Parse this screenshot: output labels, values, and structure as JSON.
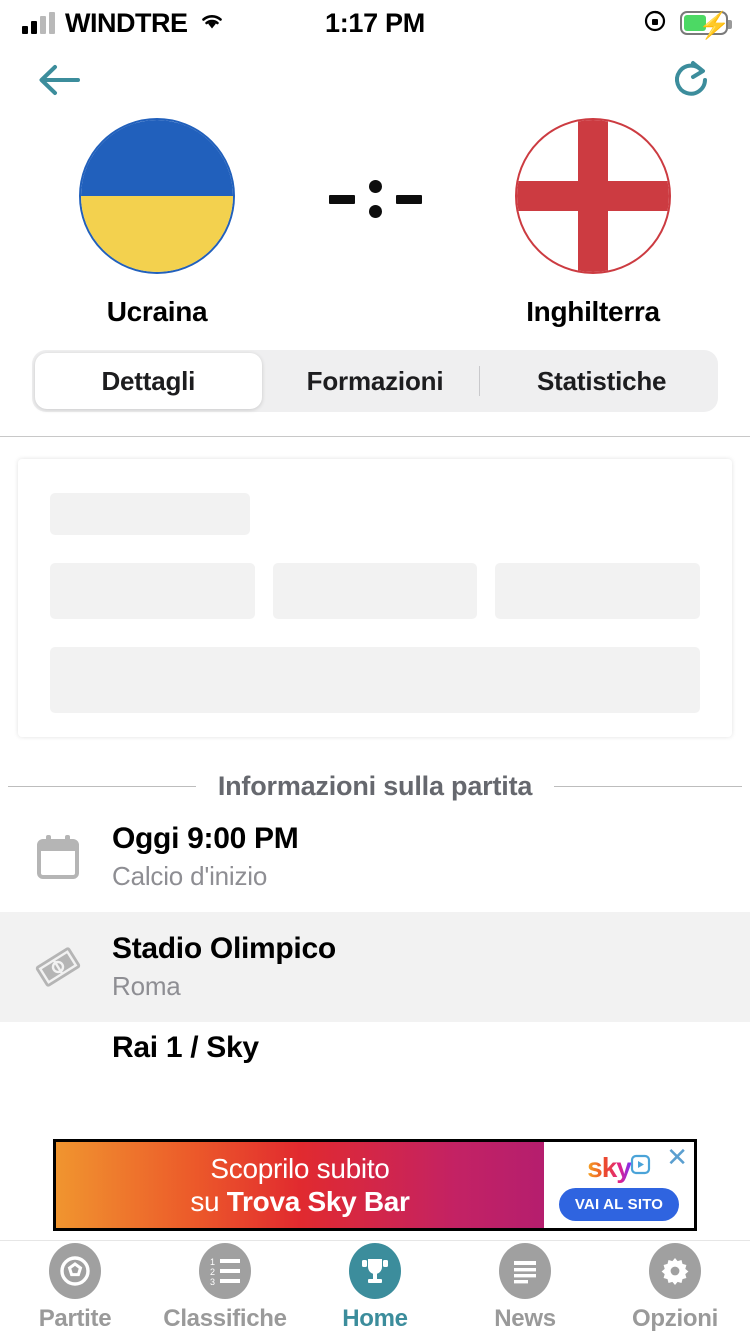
{
  "status_bar": {
    "carrier": "WINDTRE",
    "time": "1:17 PM",
    "signal_icon": "signal-bars-icon",
    "wifi_icon": "wifi-icon",
    "rotation_lock_icon": "rotation-lock-icon",
    "battery_icon": "battery-charging-icon"
  },
  "nav": {
    "back_icon": "back-arrow-icon",
    "refresh_icon": "refresh-icon",
    "accent_color": "#3c8d9c"
  },
  "match": {
    "home_team": {
      "name": "Ucraina",
      "flag_icon": "flag-ukraine-icon",
      "flag_colors": [
        "#2160bc",
        "#f3d14e"
      ]
    },
    "away_team": {
      "name": "Inghilterra",
      "flag_icon": "flag-england-icon",
      "flag_colors": [
        "#cc3b41",
        "#ffffff"
      ]
    },
    "score": {
      "home": "-",
      "separator": ":",
      "away": "-"
    }
  },
  "tabs": {
    "items": [
      {
        "label": "Dettagli",
        "active": true
      },
      {
        "label": "Formazioni",
        "active": false
      },
      {
        "label": "Statistiche",
        "active": false
      }
    ]
  },
  "skeleton": {
    "placeholder_color": "#f2f2f2",
    "blocks": 5
  },
  "section": {
    "title": "Informazioni sulla partita"
  },
  "info_rows": [
    {
      "icon": "calendar-icon",
      "title": "Oggi 9:00 PM",
      "subtitle": "Calcio d'inizio",
      "highlighted": false
    },
    {
      "icon": "stadium-icon",
      "title": "Stadio Olimpico",
      "subtitle": "Roma",
      "highlighted": true
    },
    {
      "icon": "tv-icon",
      "title": "Rai 1 / Sky",
      "subtitle": "",
      "highlighted": false
    }
  ],
  "ad": {
    "line1": "Scoprilo subito",
    "line2_prefix": "su ",
    "line2_bold": "Trova Sky Bar",
    "brand": "sky",
    "cta_label": "VAI AL SITO",
    "close_icon": "close-icon",
    "play_icon": "play-badge-icon"
  },
  "bottom_nav": {
    "items": [
      {
        "label": "Partite",
        "icon": "soccer-ball-icon",
        "active": false
      },
      {
        "label": "Classifiche",
        "icon": "ranked-list-icon",
        "active": false
      },
      {
        "label": "Home",
        "icon": "trophy-icon",
        "active": true
      },
      {
        "label": "News",
        "icon": "news-article-icon",
        "active": false
      },
      {
        "label": "Opzioni",
        "icon": "gear-icon",
        "active": false
      }
    ],
    "active_color": "#3c8d9c",
    "inactive_color": "#9a9a9a"
  }
}
